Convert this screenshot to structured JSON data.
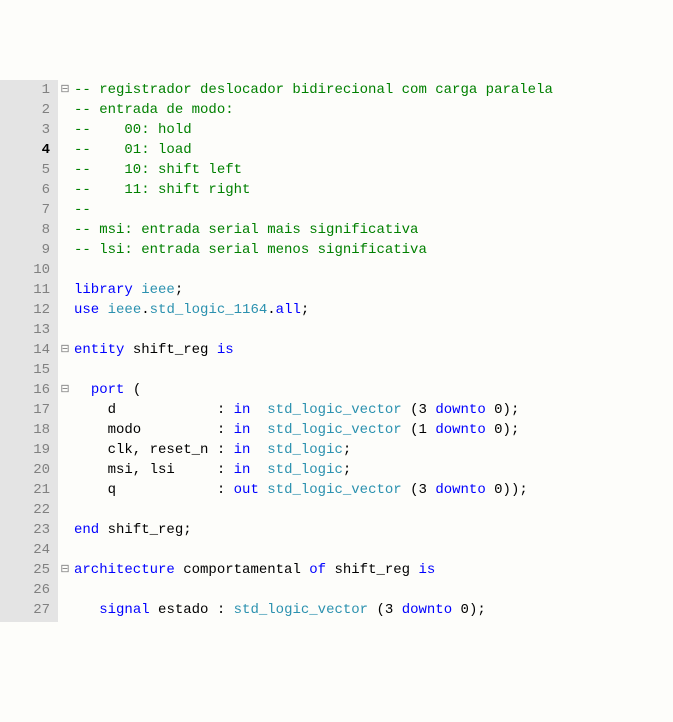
{
  "current_line": 4,
  "lines": [
    {
      "n": 1,
      "fold": "⊟",
      "tokens": [
        [
          "c",
          "-- registrador deslocador bidirecional com carga paralela"
        ]
      ]
    },
    {
      "n": 2,
      "fold": "",
      "tokens": [
        [
          "c",
          "-- entrada de modo:"
        ]
      ]
    },
    {
      "n": 3,
      "fold": "",
      "tokens": [
        [
          "c",
          "--    00: hold"
        ]
      ]
    },
    {
      "n": 4,
      "fold": "",
      "tokens": [
        [
          "c",
          "--    01: load"
        ]
      ]
    },
    {
      "n": 5,
      "fold": "",
      "tokens": [
        [
          "c",
          "--    10: shift left"
        ]
      ]
    },
    {
      "n": 6,
      "fold": "",
      "tokens": [
        [
          "c",
          "--    11: shift right"
        ]
      ]
    },
    {
      "n": 7,
      "fold": "",
      "tokens": [
        [
          "c",
          "--"
        ]
      ]
    },
    {
      "n": 8,
      "fold": "",
      "tokens": [
        [
          "c",
          "-- msi: entrada serial mais significativa"
        ]
      ]
    },
    {
      "n": 9,
      "fold": "",
      "tokens": [
        [
          "c",
          "-- lsi: entrada serial menos significativa"
        ]
      ]
    },
    {
      "n": 10,
      "fold": "",
      "tokens": []
    },
    {
      "n": 11,
      "fold": "",
      "tokens": [
        [
          "k",
          "library"
        ],
        [
          "n",
          " "
        ],
        [
          "t",
          "ieee"
        ],
        [
          "p",
          ";"
        ]
      ]
    },
    {
      "n": 12,
      "fold": "",
      "tokens": [
        [
          "k",
          "use"
        ],
        [
          "n",
          " "
        ],
        [
          "t",
          "ieee"
        ],
        [
          "p",
          "."
        ],
        [
          "t",
          "std_logic_1164"
        ],
        [
          "p",
          "."
        ],
        [
          "k",
          "all"
        ],
        [
          "p",
          ";"
        ]
      ]
    },
    {
      "n": 13,
      "fold": "",
      "tokens": []
    },
    {
      "n": 14,
      "fold": "⊟",
      "tokens": [
        [
          "k",
          "entity"
        ],
        [
          "n",
          " shift_reg "
        ],
        [
          "k",
          "is"
        ]
      ]
    },
    {
      "n": 15,
      "fold": "",
      "tokens": []
    },
    {
      "n": 16,
      "fold": "⊟",
      "tokens": [
        [
          "n",
          "  "
        ],
        [
          "k",
          "port"
        ],
        [
          "n",
          " "
        ],
        [
          "p",
          "("
        ]
      ]
    },
    {
      "n": 17,
      "fold": "",
      "tokens": [
        [
          "n",
          "    d            : "
        ],
        [
          "k",
          "in"
        ],
        [
          "n",
          "  "
        ],
        [
          "t",
          "std_logic_vector"
        ],
        [
          "n",
          " "
        ],
        [
          "p",
          "("
        ],
        [
          "n",
          "3 "
        ],
        [
          "k",
          "downto"
        ],
        [
          "n",
          " 0"
        ],
        [
          "p",
          ")"
        ],
        [
          "p",
          ";"
        ]
      ]
    },
    {
      "n": 18,
      "fold": "",
      "tokens": [
        [
          "n",
          "    modo         : "
        ],
        [
          "k",
          "in"
        ],
        [
          "n",
          "  "
        ],
        [
          "t",
          "std_logic_vector"
        ],
        [
          "n",
          " "
        ],
        [
          "p",
          "("
        ],
        [
          "n",
          "1 "
        ],
        [
          "k",
          "downto"
        ],
        [
          "n",
          " 0"
        ],
        [
          "p",
          ")"
        ],
        [
          "p",
          ";"
        ]
      ]
    },
    {
      "n": 19,
      "fold": "",
      "tokens": [
        [
          "n",
          "    clk, reset_n : "
        ],
        [
          "k",
          "in"
        ],
        [
          "n",
          "  "
        ],
        [
          "t",
          "std_logic"
        ],
        [
          "p",
          ";"
        ]
      ]
    },
    {
      "n": 20,
      "fold": "",
      "tokens": [
        [
          "n",
          "    msi, lsi     : "
        ],
        [
          "k",
          "in"
        ],
        [
          "n",
          "  "
        ],
        [
          "t",
          "std_logic"
        ],
        [
          "p",
          ";"
        ]
      ]
    },
    {
      "n": 21,
      "fold": "",
      "tokens": [
        [
          "n",
          "    q            : "
        ],
        [
          "k",
          "out"
        ],
        [
          "n",
          " "
        ],
        [
          "t",
          "std_logic_vector"
        ],
        [
          "n",
          " "
        ],
        [
          "p",
          "("
        ],
        [
          "n",
          "3 "
        ],
        [
          "k",
          "downto"
        ],
        [
          "n",
          " 0"
        ],
        [
          "p",
          ")"
        ],
        [
          "p",
          ")"
        ],
        [
          "p",
          ";"
        ]
      ]
    },
    {
      "n": 22,
      "fold": "",
      "tokens": []
    },
    {
      "n": 23,
      "fold": "",
      "tokens": [
        [
          "k",
          "end"
        ],
        [
          "n",
          " shift_reg"
        ],
        [
          "p",
          ";"
        ]
      ]
    },
    {
      "n": 24,
      "fold": "",
      "tokens": []
    },
    {
      "n": 25,
      "fold": "⊟",
      "tokens": [
        [
          "k",
          "architecture"
        ],
        [
          "n",
          " comportamental "
        ],
        [
          "k",
          "of"
        ],
        [
          "n",
          " shift_reg "
        ],
        [
          "k",
          "is"
        ]
      ]
    },
    {
      "n": 26,
      "fold": "",
      "tokens": []
    },
    {
      "n": 27,
      "fold": "",
      "tokens": [
        [
          "n",
          "   "
        ],
        [
          "k",
          "signal"
        ],
        [
          "n",
          " estado : "
        ],
        [
          "t",
          "std_logic_vector"
        ],
        [
          "n",
          " "
        ],
        [
          "p",
          "("
        ],
        [
          "n",
          "3 "
        ],
        [
          "k",
          "downto"
        ],
        [
          "n",
          " 0"
        ],
        [
          "p",
          ")"
        ],
        [
          "p",
          ";"
        ]
      ]
    }
  ]
}
